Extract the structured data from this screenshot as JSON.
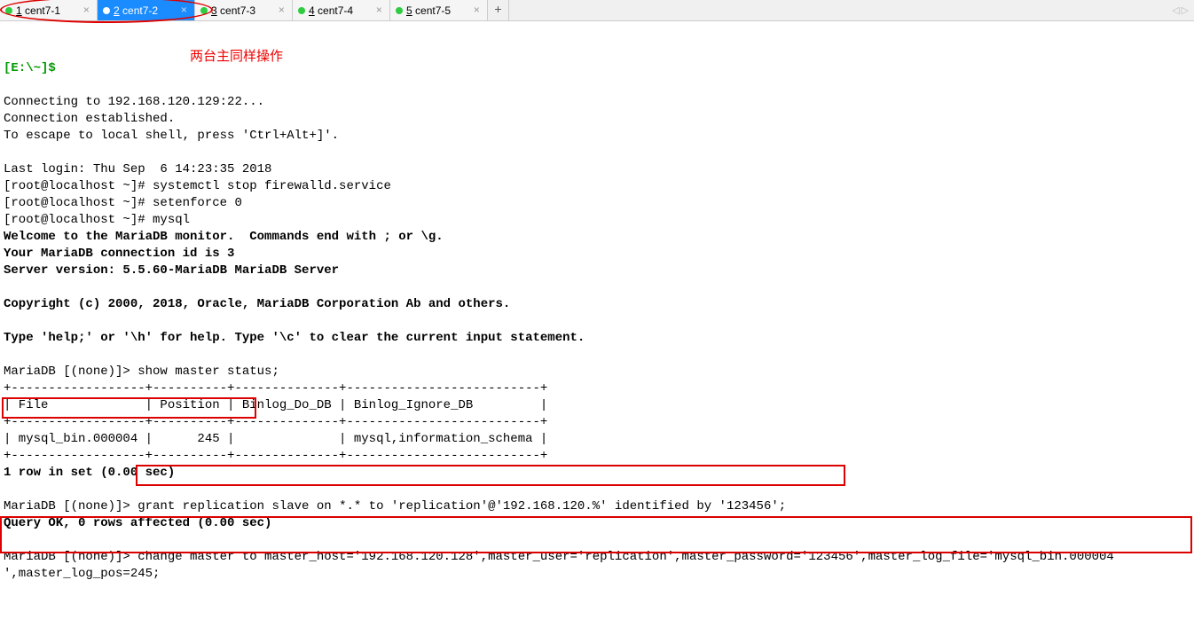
{
  "tabs": [
    {
      "num": "1",
      "name": "cent7-1",
      "active": false
    },
    {
      "num": "2",
      "name": "cent7-2",
      "active": true
    },
    {
      "num": "3",
      "name": "cent7-3",
      "active": false
    },
    {
      "num": "4",
      "name": "cent7-4",
      "active": false
    },
    {
      "num": "5",
      "name": "cent7-5",
      "active": false
    }
  ],
  "tab_add": "+",
  "nav_left": "◁",
  "nav_right": "▷",
  "annotation": "两台主同样操作",
  "terminal": {
    "prompt": "[E:\\~]$",
    "lines": {
      "l1": "Connecting to 192.168.120.129:22...",
      "l2": "Connection established.",
      "l3": "To escape to local shell, press 'Ctrl+Alt+]'.",
      "l4": "Last login: Thu Sep  6 14:23:35 2018",
      "l5": "[root@localhost ~]# systemctl stop firewalld.service",
      "l6": "[root@localhost ~]# setenforce 0",
      "l7": "[root@localhost ~]# mysql",
      "l8": "Welcome to the MariaDB monitor.  Commands end with ; or \\g.",
      "l9": "Your MariaDB connection id is 3",
      "l10": "Server version: 5.5.60-MariaDB MariaDB Server",
      "l11": "Copyright (c) 2000, 2018, Oracle, MariaDB Corporation Ab and others.",
      "l12": "Type 'help;' or '\\h' for help. Type '\\c' to clear the current input statement.",
      "l13": "MariaDB [(none)]> show master status;",
      "l14": "+------------------+----------+--------------+--------------------------+",
      "l15": "| File             | Position | Binlog_Do_DB | Binlog_Ignore_DB         |",
      "l16": "+------------------+----------+--------------+--------------------------+",
      "l17": "| mysql_bin.000004 |      245 |              | mysql,information_schema |",
      "l18": "+------------------+----------+--------------+--------------------------+",
      "l19": "1 row in set (0.00 sec)",
      "l20a": "MariaDB [(none)]>",
      "l20b": " grant replication slave on *.* to 'replication'@'192.168.120.%' identified by '123456';",
      "l21": "Query OK, 0 rows affected (0.00 sec)",
      "l22a": "MariaDB [(none)]> change master to master_host='192.168.120.128",
      "l22b": ",master_user='replication',master_password='123456',master_log_file='mysql_bin.000004",
      "l23": "',master_log_pos=245;"
    }
  }
}
